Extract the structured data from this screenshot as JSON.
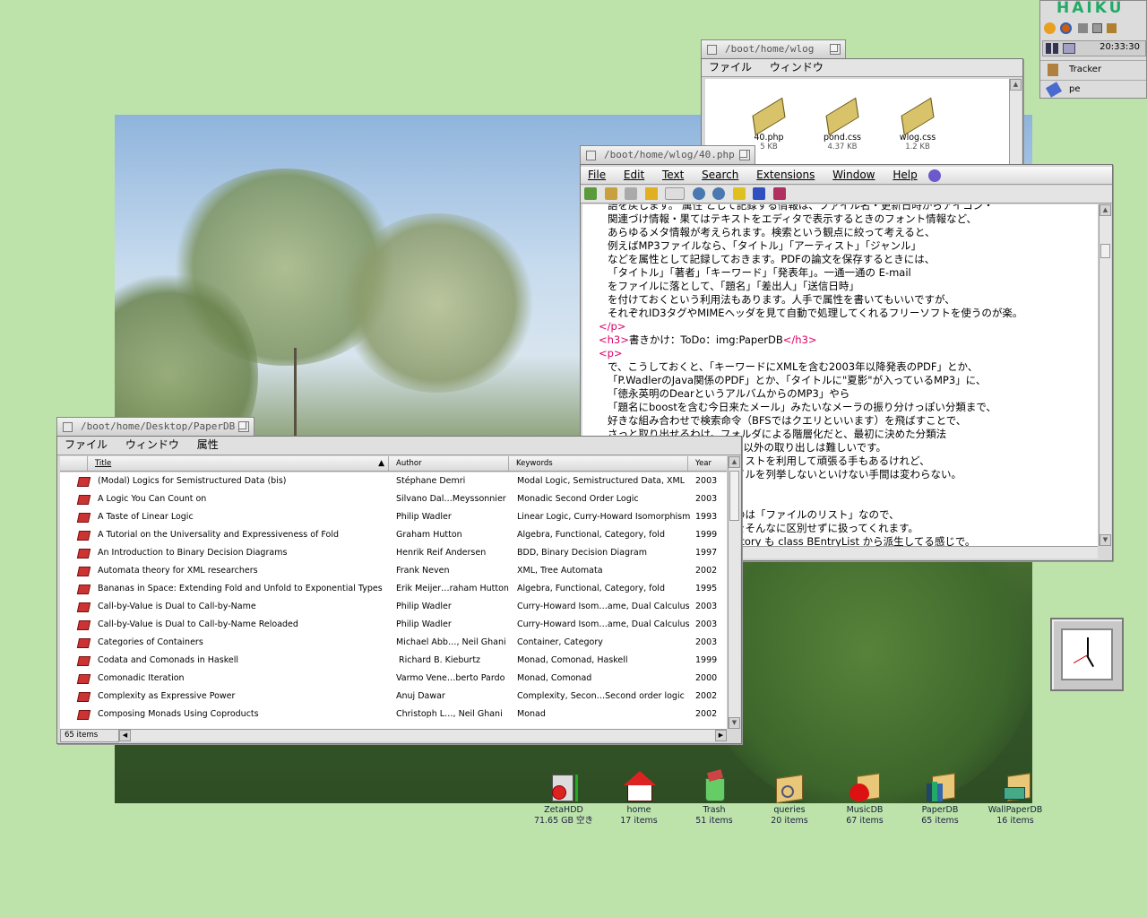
{
  "deskbar": {
    "logo": "HAIKU",
    "clock": "20:33:30",
    "apps": [
      {
        "label": "Tracker",
        "icon": "tracker-icon"
      },
      {
        "label": "pe",
        "icon": "pe-editor-icon"
      }
    ]
  },
  "wlog": {
    "title": "/boot/home/wlog",
    "menu": [
      "ファイル",
      "ウィンドウ"
    ],
    "files": [
      {
        "name": "40.php",
        "size": "5 KB"
      },
      {
        "name": "pond.css",
        "size": "4.37 KB"
      },
      {
        "name": "wlog.css",
        "size": "1.2 KB"
      }
    ]
  },
  "editor": {
    "title": "/boot/home/wlog/40.php",
    "menu": [
      "File",
      "Edit",
      "Text",
      "Search",
      "Extensions",
      "Window",
      "Help"
    ],
    "lines_top": [
      "語を戻します。 属性 として記録する情報は、ファイル名・更新日時からアイコン・",
      "関連づけ情報・果てはテキストをエディタで表示するときのフォント情報など、",
      "あらゆるメタ情報が考えられます。検索という観点に絞って考えると、",
      "例えばMP3ファイルなら、「タイトル」「アーティスト」「ジャンル」",
      "などを属性として記録しておきます。PDFの論文を保存するときには、",
      "「タイトル」「著者」「キーワード」「発表年」。一通一通の E-mail",
      "をファイルに落として、「題名」「差出人」「送信日時」",
      "を付けておくという利用法もあります。人手で属性を書いてもいいですが、",
      "それぞれID3タグやMIMEヘッダを見て自動で処理してくれるフリーソフトを使うのが楽。"
    ],
    "close_p": "</p>",
    "h3_open": "<h3>",
    "h3_text": "書きかけ：ToDo：img:PaperDB",
    "h3_close": "</h3>",
    "p_open": "<p>",
    "lines_bottom": [
      "で、こうしておくと、「キーワードにXMLを含む2003年以降発表のPDF」とか、",
      "「P.WadlerのJava関係のPDF」とか、「タイトルに\"夏影\"が入っているMP3」に、",
      "「徳永英明のDearというアルバムからのMP3」やら",
      "「題名にboostを含む今日来たメール」みたいなメーラの振り分けっぽい分類まで、",
      "好きな組み合わせで検索命令（BFSではクエリといいます）を飛ばすことで、",
      "さっと取り出せるわけ。フォルダによる階層化だと、最初に決めた分類法",
      "）以外の取り出しは難しいです。",
      "リストを利用して頑張る手もあるけれど、",
      "イルを列挙しないといけない手間は変わらない。",
      "",
      "",
      "のは「ファイルのリスト」なので、",
      "をそんなに区別せずに扱ってくれます。",
      "ctory も class BEntryList から派生してる感じで。"
    ]
  },
  "paperdb": {
    "title": "/boot/home/Desktop/PaperDB",
    "menu": [
      "ファイル",
      "ウィンドウ",
      "属性"
    ],
    "columns": [
      "Title",
      "Author",
      "Keywords",
      "Year"
    ],
    "rows": [
      [
        "(Modal) Logics for Semistructured Data (bis)",
        "Stéphane Demri",
        "Modal Logic, Semistructured Data, XML",
        "2003"
      ],
      [
        "A Logic You Can Count on",
        "Silvano Dal…Meyssonnier",
        "Monadic Second Order Logic",
        "2003"
      ],
      [
        "A Taste of Linear Logic",
        "Philip Wadler",
        "Linear Logic, Curry-Howard Isomorphism",
        "1993"
      ],
      [
        "A Tutorial on the Universality and Expressiveness of Fold",
        "Graham Hutton",
        "Algebra, Functional, Category, fold",
        "1999"
      ],
      [
        "An Introduction to Binary Decision Diagrams",
        "Henrik Reif Andersen",
        "BDD, Binary Decision Diagram",
        "1997"
      ],
      [
        "Automata theory for XML researchers",
        "Frank Neven",
        "XML, Tree Automata",
        "2002"
      ],
      [
        "Bananas in Space: Extending Fold and Unfold to Exponential Types",
        "Erik Meijer…raham Hutton",
        "Algebra, Functional, Category, fold",
        "1995"
      ],
      [
        "Call-by-Value is Dual to Call-by-Name",
        "Philip Wadler",
        "Curry-Howard Isom…ame, Dual Calculus",
        "2003"
      ],
      [
        "Call-by-Value is Dual to Call-by-Name Reloaded",
        "Philip Wadler",
        "Curry-Howard Isom…ame, Dual Calculus",
        "2003"
      ],
      [
        "Categories of Containers",
        "Michael Abb…, Neil Ghani",
        "Container, Category",
        "2003"
      ],
      [
        "Codata and Comonads in Haskell",
        "Richard B. Kieburtz",
        "Monad, Comonad, Haskell",
        "1999"
      ],
      [
        "Comonadic Iteration",
        "Varmo Vene…berto Pardo",
        "Monad, Comonad",
        "2000"
      ],
      [
        "Complexity as Expressive Power",
        "Anuj Dawar",
        "Complexity, Secon…Second order logic",
        "2002"
      ],
      [
        "Composing Monads Using Coproducts",
        "Christoph L…, Neil Ghani",
        "Monad",
        "2002"
      ]
    ],
    "status": "65 items"
  },
  "desktop_icons": [
    {
      "label": "ZetaHDD",
      "sub": "71.65 GB 空き",
      "icon": "hard-disk-icon"
    },
    {
      "label": "home",
      "sub": "17 items",
      "icon": "home-icon"
    },
    {
      "label": "Trash",
      "sub": "51 items",
      "icon": "trash-icon"
    },
    {
      "label": "queries",
      "sub": "20 items",
      "icon": "queries-folder-icon"
    },
    {
      "label": "MusicDB",
      "sub": "67 items",
      "icon": "music-folder-icon"
    },
    {
      "label": "PaperDB",
      "sub": "65 items",
      "icon": "books-folder-icon"
    },
    {
      "label": "WallPaperDB",
      "sub": "16 items",
      "icon": "wallpaper-folder-icon"
    }
  ],
  "colors": {
    "desktop": "#bde3ab",
    "tag_accent": "#d06",
    "year_accent": "#b22"
  }
}
